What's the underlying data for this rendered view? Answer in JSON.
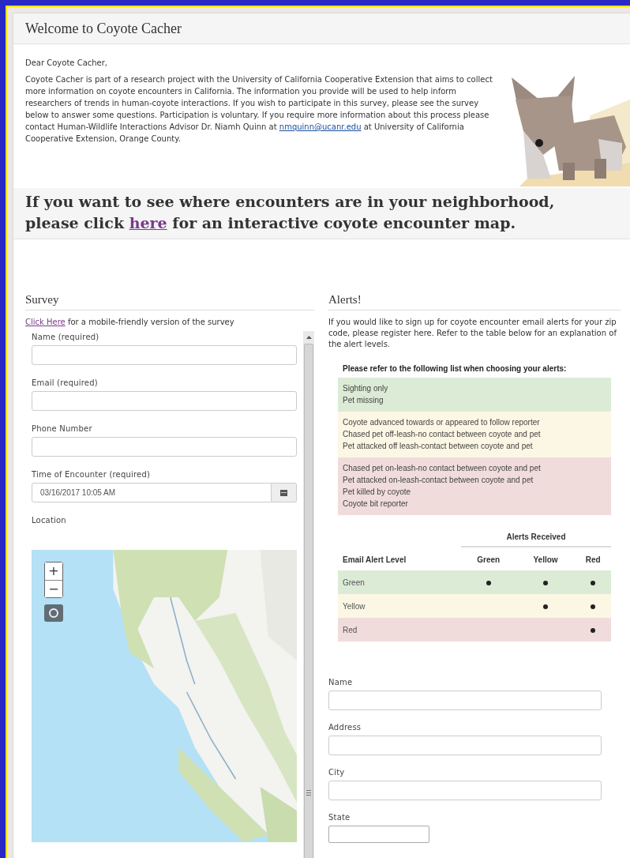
{
  "page": {
    "title": "Welcome to Coyote Cacher"
  },
  "intro": {
    "greeting": "Dear Coyote Cacher,",
    "paragraph_before_email": "Coyote Cacher is part of a research project with the University of California Cooperative Extension that aims to collect more information on coyote encounters in California.  The information you provide will be used to help inform researchers of trends in human-coyote interactions. If you wish to participate in this survey, please see the survey below to answer some questions. Participation is voluntary.  If you require more information about this process please contact Human-Wildlife Interactions Advisor Dr. Niamh Quinn at",
    "email_link": "nmquinn@ucanr.edu",
    "paragraph_after_email": "at University of California Cooperative Extension, Orange County."
  },
  "banner": {
    "before_link": "If you want to see where encounters are in your neighborhood, please click",
    "link": "here",
    "after_link": "for an interactive coyote encounter map."
  },
  "survey": {
    "heading": "Survey",
    "mobile_link": "Click Here",
    "mobile_text": "for a mobile-friendly version of the survey",
    "fields": [
      {
        "label": "Name (required)",
        "kind": "text"
      },
      {
        "label": "Email (required)",
        "kind": "text"
      },
      {
        "label": "Phone Number",
        "kind": "text"
      },
      {
        "label": "Time of Encounter (required)",
        "kind": "datetime",
        "value": "03/16/2017 10:05 AM"
      },
      {
        "label": "Location",
        "kind": "map"
      }
    ],
    "map_controls": [
      "+",
      "−"
    ]
  },
  "alerts": {
    "heading": "Alerts!",
    "intro": "If you would like to sign up for coyote encounter email alerts for your zip code, please register here. Refer to the table below for an explanation of the alert levels.",
    "legend_title": "Please refer to the following list when choosing your alerts:",
    "legend_groups": [
      {
        "color": "#dcebd6",
        "items": [
          "Sighting only",
          "Pet missing"
        ]
      },
      {
        "color": "#fcf7e4",
        "items": [
          "Coyote advanced towards or appeared to follow reporter",
          "Chased pet off-leash-no contact between coyote and pet",
          "Pet attacked off leash-contact between coyote and pet"
        ]
      },
      {
        "color": "#f1dcdc",
        "items": [
          "Chased pet on-leash-no contact between coyote and pet",
          "Pet attacked on-leash-contact between coyote and pet",
          "Pet killed by coyote",
          "Coyote bit reporter"
        ]
      }
    ],
    "table": {
      "group_heading": "Alerts Received",
      "columns": [
        "Email Alert Level",
        "Green",
        "Yellow",
        "Red"
      ],
      "rows": [
        {
          "level": "Green",
          "color": "#dcebd6",
          "received": [
            true,
            true,
            true
          ]
        },
        {
          "level": "Yellow",
          "color": "#fcf7e4",
          "received": [
            false,
            true,
            true
          ]
        },
        {
          "level": "Red",
          "color": "#f1dcdc",
          "received": [
            false,
            false,
            true
          ]
        }
      ]
    },
    "fields": [
      {
        "label": "Name",
        "kind": "text"
      },
      {
        "label": "Address",
        "kind": "text"
      },
      {
        "label": "City",
        "kind": "text"
      },
      {
        "label": "State",
        "kind": "select"
      }
    ]
  }
}
